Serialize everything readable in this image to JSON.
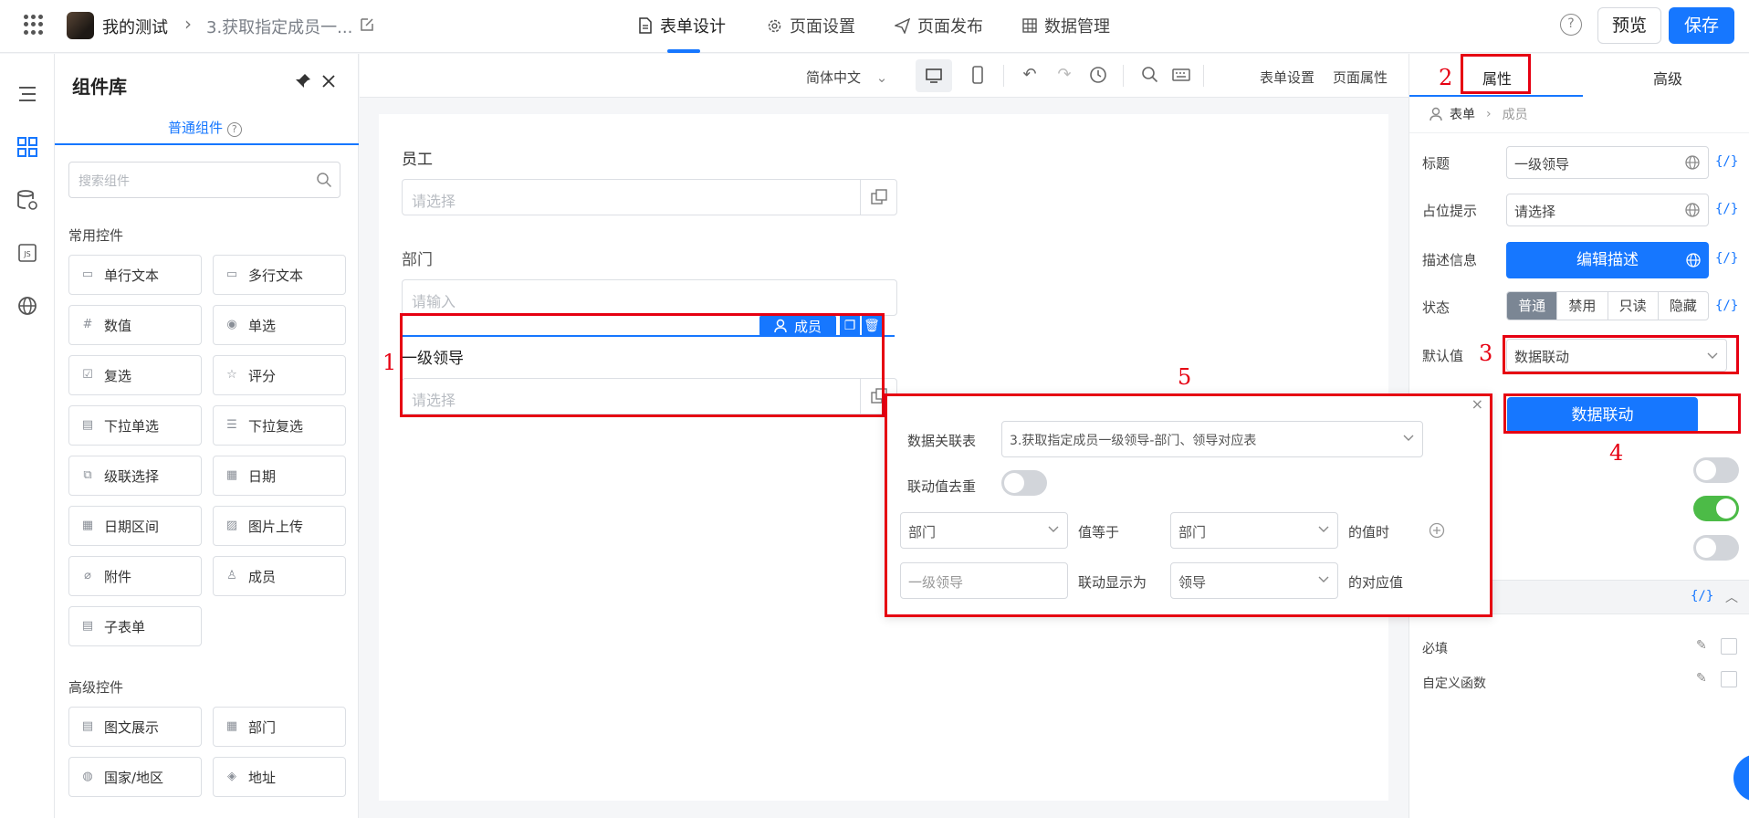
{
  "header": {
    "app_name": "我的测试",
    "page_name": "3.获取指定成员一...",
    "tabs": [
      {
        "label": "表单设计",
        "icon": "document-icon",
        "active": true
      },
      {
        "label": "页面设置",
        "icon": "gear-icon"
      },
      {
        "label": "页面发布",
        "icon": "send-icon"
      },
      {
        "label": "数据管理",
        "icon": "grid-icon"
      }
    ],
    "help": "?",
    "preview_label": "预览",
    "save_label": "保存"
  },
  "library": {
    "title": "组件库",
    "tab": "普通组件",
    "search_placeholder": "搜索组件",
    "common_section": "常用控件",
    "common": [
      {
        "label": "单行文本",
        "icon": "▭"
      },
      {
        "label": "多行文本",
        "icon": "▭"
      },
      {
        "label": "数值",
        "icon": "#"
      },
      {
        "label": "单选",
        "icon": "◉"
      },
      {
        "label": "复选",
        "icon": "☑"
      },
      {
        "label": "评分",
        "icon": "☆"
      },
      {
        "label": "下拉单选",
        "icon": "▤"
      },
      {
        "label": "下拉复选",
        "icon": "☰"
      },
      {
        "label": "级联选择",
        "icon": "⧉"
      },
      {
        "label": "日期",
        "icon": "▦"
      },
      {
        "label": "日期区间",
        "icon": "▦"
      },
      {
        "label": "图片上传",
        "icon": "▨"
      },
      {
        "label": "附件",
        "icon": "⌀"
      },
      {
        "label": "成员",
        "icon": "♙"
      },
      {
        "label": "子表单",
        "icon": "▤"
      }
    ],
    "advanced_section": "高级控件",
    "advanced": [
      {
        "label": "图文展示",
        "icon": "▤"
      },
      {
        "label": "部门",
        "icon": "▦"
      },
      {
        "label": "国家/地区",
        "icon": "◍"
      },
      {
        "label": "地址",
        "icon": "◈"
      }
    ]
  },
  "toolbar": {
    "language": "简体中文",
    "form_settings": "表单设置",
    "page_props": "页面属性"
  },
  "canvas": {
    "fields": [
      {
        "label": "员工",
        "placeholder": "请选择"
      },
      {
        "label": "部门",
        "placeholder": "请输入"
      },
      {
        "label": "一级领导",
        "placeholder": "请选择"
      }
    ],
    "selected_badge": "成员"
  },
  "annotations": [
    "1",
    "2",
    "3",
    "4",
    "5"
  ],
  "popup": {
    "table_label": "数据关联表",
    "table_value": "3.获取指定成员一级领导-部门、领导对应表",
    "dedupe_label": "联动值去重",
    "dedupe_on": false,
    "row1": {
      "field": "部门",
      "op": "值等于",
      "target": "部门",
      "suffix": "的值时"
    },
    "row2": {
      "field": "一级领导",
      "op": "联动显示为",
      "target": "领导",
      "suffix": "的对应值"
    }
  },
  "props": {
    "tab_attr": "属性",
    "tab_adv": "高级",
    "crumb_form": "表单",
    "crumb_member": "成员",
    "title_label": "标题",
    "title_value": "一级领导",
    "placeholder_label": "占位提示",
    "placeholder_value": "请选择",
    "desc_label": "描述信息",
    "desc_button": "编辑描述",
    "status_label": "状态",
    "status_options": [
      "普通",
      "禁用",
      "只读",
      "隐藏"
    ],
    "status_selected": "普通",
    "default_label": "默认值",
    "default_value": "数据联动",
    "linkage_button": "数据联动",
    "code_icon": "{/}",
    "toggles": [
      false,
      true,
      false
    ],
    "required_label": "必填",
    "custom_fn_label": "自定义函数"
  },
  "colors": {
    "accent": "#1677ff",
    "annotation": "#e60012",
    "toggle_on": "#4cbb47"
  }
}
